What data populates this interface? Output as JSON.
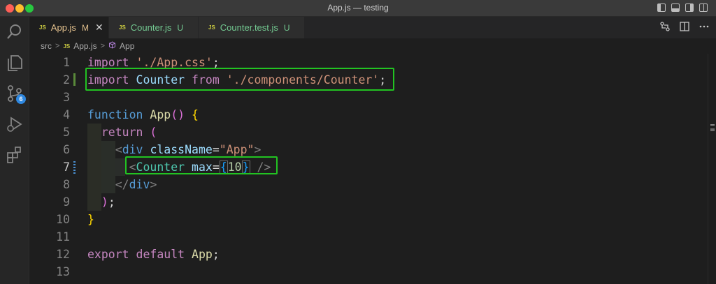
{
  "window": {
    "title": "App.js — testing"
  },
  "activity_bar": {
    "items": [
      {
        "icon": "search-icon"
      },
      {
        "icon": "explorer-icon"
      },
      {
        "icon": "source-control-icon",
        "badge": "6"
      },
      {
        "icon": "run-debug-icon"
      },
      {
        "icon": "extensions-icon"
      }
    ]
  },
  "tabs": [
    {
      "badge": "JS",
      "name": "App.js",
      "status": "M",
      "close": "✕",
      "active": true
    },
    {
      "badge": "JS",
      "name": "Counter.js",
      "status": "U",
      "active": false
    },
    {
      "badge": "JS",
      "name": "Counter.test.js",
      "status": "U",
      "active": false
    }
  ],
  "breadcrumbs": {
    "folder": "src",
    "file_badge": "JS",
    "file": "App.js",
    "symbol": "App"
  },
  "editor": {
    "current_line": 7,
    "lines": [
      {
        "n": "1"
      },
      {
        "n": "2"
      },
      {
        "n": "3"
      },
      {
        "n": "4"
      },
      {
        "n": "5"
      },
      {
        "n": "6"
      },
      {
        "n": "7"
      },
      {
        "n": "8"
      },
      {
        "n": "9"
      },
      {
        "n": "10"
      },
      {
        "n": "11"
      },
      {
        "n": "12"
      },
      {
        "n": "13"
      }
    ],
    "tokens": {
      "l1": [
        "import",
        " ",
        "'./App.css'",
        ";"
      ],
      "l2": [
        "import",
        " ",
        "Counter",
        " ",
        "from",
        " ",
        "'./components/Counter'",
        ";"
      ],
      "l4": [
        "function",
        " ",
        "App",
        "()",
        " ",
        "{"
      ],
      "l5": [
        "return",
        " ",
        "("
      ],
      "l6": [
        "<",
        "div",
        " ",
        "className",
        "=",
        "\"App\"",
        ">"
      ],
      "l7": [
        "<",
        "Counter",
        " ",
        "max",
        "=",
        "{",
        "10",
        "}",
        " ",
        "/>"
      ],
      "l8": [
        "</",
        "div",
        ">"
      ],
      "l9": [
        ")",
        ";"
      ],
      "l10": [
        "}"
      ],
      "l12": [
        "export",
        " ",
        "default",
        " ",
        "App",
        ";"
      ]
    }
  },
  "colors": {
    "highlight_box": "#22c322",
    "accent": "#2f88e0"
  }
}
